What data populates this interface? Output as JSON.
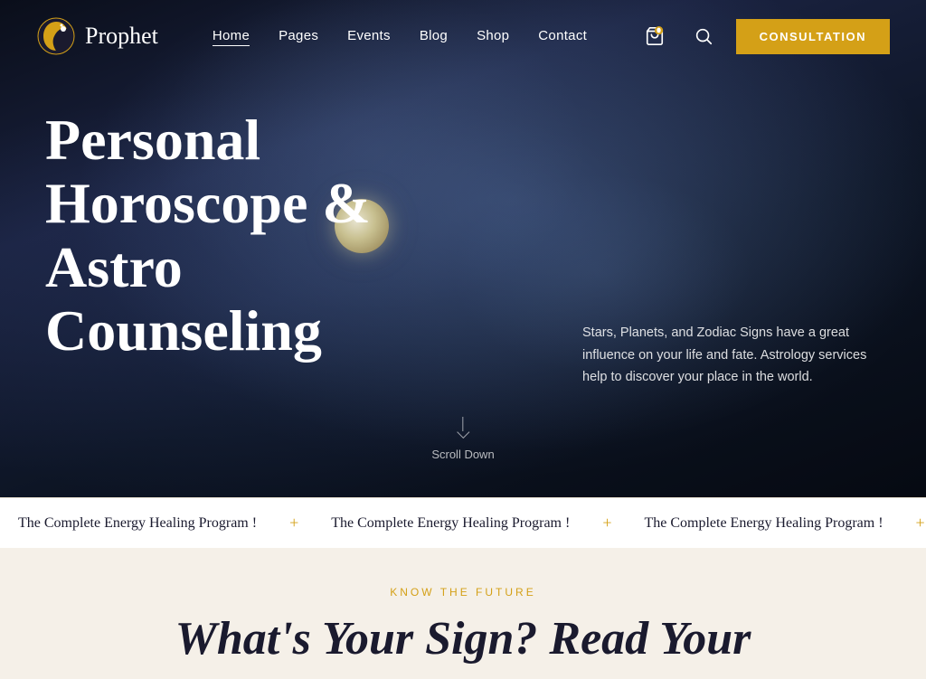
{
  "brand": {
    "name": "Prophet"
  },
  "nav": {
    "links": [
      {
        "label": "Home",
        "active": true
      },
      {
        "label": "Pages",
        "active": false
      },
      {
        "label": "Events",
        "active": false
      },
      {
        "label": "Blog",
        "active": false
      },
      {
        "label": "Shop",
        "active": false
      },
      {
        "label": "Contact",
        "active": false
      }
    ],
    "consultation_label": "CONSULTATION"
  },
  "hero": {
    "headline": "Personal Horoscope & Astro Counseling",
    "description": "Stars, Planets, and Zodiac Signs have a great influence on your life and fate. Astrology services help to discover your place in the world.",
    "scroll_label": "Scroll Down"
  },
  "ticker": {
    "items": [
      "The Complete Energy Healing Program !",
      "The Complete Energy Healing Program !",
      "The Complete Energy Healing Program !",
      "The Complete Energy Healing Program !",
      "The Complete Energy Healing Program !",
      "The Complete Energy Healing Program !"
    ]
  },
  "below": {
    "know_label": "KNOW THE FUTURE",
    "heading_start": "What's Your Sign? Read Your"
  }
}
